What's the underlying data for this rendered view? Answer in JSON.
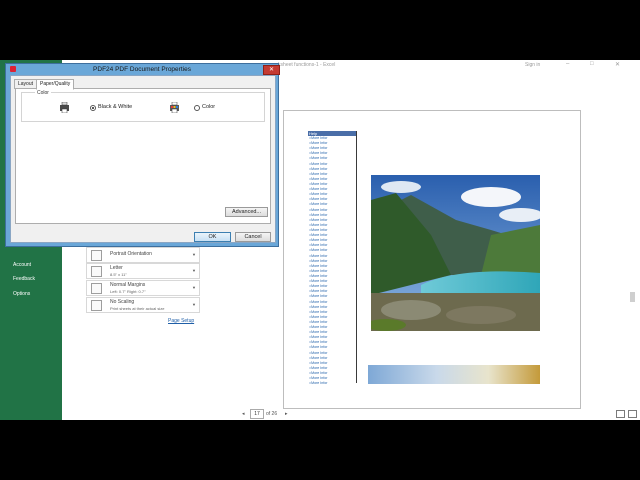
{
  "excel": {
    "title": "worksheet functions-1  -  Excel",
    "sign_in": "Sign in",
    "window_controls": {
      "minimize": "–",
      "maximize": "□",
      "close": "✕"
    }
  },
  "sidebar": {
    "items": [
      {
        "label": "Account"
      },
      {
        "label": "Feedback"
      },
      {
        "label": "Options"
      }
    ]
  },
  "settings": [
    {
      "line1": "Portrait Orientation",
      "line2": ""
    },
    {
      "line1": "Letter",
      "line2": "8.5\" x 11\""
    },
    {
      "line1": "Normal Margins",
      "line2": "Left:  0.7\"    Right:  0.7\""
    },
    {
      "line1": "No Scaling",
      "line2": "Print sheets at their actual size"
    }
  ],
  "page_setup_link": "Page Setup",
  "preview": {
    "column_header": "Help",
    "list_items": [
      "=More Infor",
      "=More Infor",
      "=More Infor",
      "=More Infor",
      "=More Infor",
      "=More Infor",
      "=More Infor",
      "=More Infor",
      "=More Infor",
      "=More Infor",
      "=More Infor",
      "=More Infor",
      "=More Infor",
      "=More Infor",
      "=More Infor",
      "=More Infor",
      "=More Infor",
      "=More Infor",
      "=More Infor",
      "=More Infor",
      "=More Infor",
      "=More Infor",
      "=More Infor",
      "=More Infor",
      "=More Infor",
      "=More Infor",
      "=More Infor",
      "=More Infor",
      "=More Infor",
      "=More Infor",
      "=More Infor",
      "=More Infor",
      "=More Infor",
      "=More Infor",
      "=More Infor",
      "=More Infor",
      "=More Infor",
      "=More Infor",
      "=More Infor",
      "=More Infor",
      "=More Infor",
      "=More Infor",
      "=More Infor",
      "=More Infor",
      "=More Infor",
      "=More Infor",
      "=More Infor",
      "=More Infor",
      "=More Infor"
    ]
  },
  "pager": {
    "prev": "◂",
    "current": "17",
    "of_label": "of 26",
    "next": "▸"
  },
  "dialog": {
    "title": "PDF24 PDF Document Properties",
    "close": "✕",
    "tabs": [
      {
        "label": "Layout"
      },
      {
        "label": "Paper/Quality"
      }
    ],
    "color_group_label": "Color",
    "options": [
      {
        "label": "Black & White",
        "selected": true
      },
      {
        "label": "Color",
        "selected": false
      }
    ],
    "advanced_button": "Advanced...",
    "ok_button": "OK",
    "cancel_button": "Cancel"
  },
  "colors": {
    "excel_green": "#217346",
    "dialog_frame": "#6aa7d8",
    "close_red": "#c43a32"
  }
}
